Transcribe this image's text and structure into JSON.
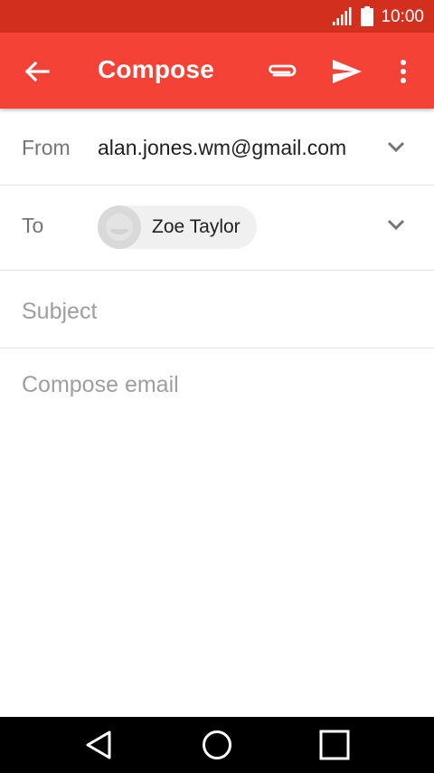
{
  "status": {
    "time": "10:00"
  },
  "appbar": {
    "title": "Compose",
    "back_icon": "arrow-back-icon",
    "attach_icon": "paperclip-icon",
    "send_icon": "send-icon",
    "more_icon": "more-vert-icon"
  },
  "from": {
    "label": "From",
    "value": "alan.jones.wm@gmail.com"
  },
  "to": {
    "label": "To",
    "recipients": [
      {
        "name": "Zoe Taylor"
      }
    ]
  },
  "subject": {
    "placeholder": "Subject"
  },
  "body": {
    "placeholder": "Compose email"
  },
  "colors": {
    "status_bar": "#d32f1f",
    "app_bar": "#f44336"
  }
}
